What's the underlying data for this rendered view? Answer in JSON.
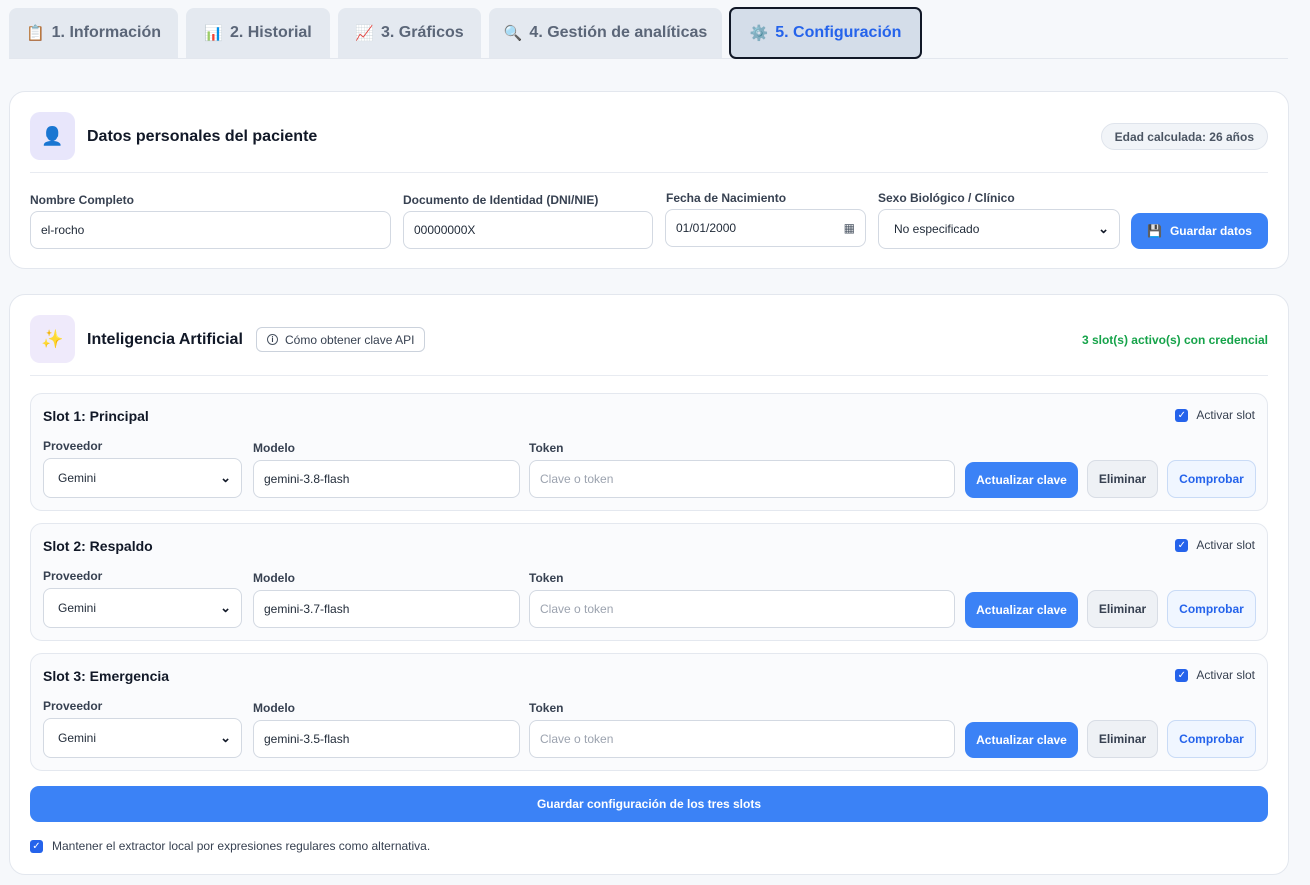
{
  "tabs": [
    {
      "icon": "📋",
      "label": "1. Información",
      "active": false
    },
    {
      "icon": "📊",
      "label": "2. Historial",
      "active": false
    },
    {
      "icon": "📈",
      "label": "3. Gráficos",
      "active": false
    },
    {
      "icon": "🔍",
      "label": "4. Gestión de analíticas",
      "active": false
    },
    {
      "icon": "⚙️",
      "label": "5. Configuración",
      "active": true
    }
  ],
  "personal": {
    "icon": "👤",
    "title": "Datos personales del paciente",
    "age_badge": "Edad calculada: 26 años",
    "name_label": "Nombre Completo",
    "name_value": "el-rocho",
    "doc_label": "Documento de Identidad (DNI/NIE)",
    "doc_value": "00000000X",
    "birth_label": "Fecha de Nacimiento",
    "birth_value": "01/01/2000",
    "sex_label": "Sexo Biológico / Clínico",
    "sex_value": "No especificado",
    "save_icon": "💾",
    "save_label": "Guardar datos"
  },
  "ai": {
    "icon": "✨",
    "title": "Inteligencia Artificial",
    "help_label": "Cómo obtener clave API",
    "status": "3 slot(s) activo(s) con credencial",
    "provider_label": "Proveedor",
    "model_label": "Modelo",
    "token_label": "Token",
    "token_placeholder": "Clave o token",
    "toggle_label": "Activar slot",
    "update_label": "Actualizar clave",
    "delete_label": "Eliminar",
    "check_label": "Comprobar",
    "slots": [
      {
        "title": "Slot 1: Principal",
        "provider": "Gemini",
        "model": "gemini-3.8-flash",
        "active": true
      },
      {
        "title": "Slot 2: Respaldo",
        "provider": "Gemini",
        "model": "gemini-3.7-flash",
        "active": true
      },
      {
        "title": "Slot 3: Emergencia",
        "provider": "Gemini",
        "model": "gemini-3.5-flash",
        "active": true
      }
    ],
    "save_all_label": "Guardar configuración de los tres slots",
    "fallback_label": "Mantener el extractor local por expresiones regulares como alternativa.",
    "fallback_checked": true
  },
  "colors": {
    "accent": "#3b82f6",
    "active_tab_text": "#2563eb",
    "success": "#16a34a"
  }
}
